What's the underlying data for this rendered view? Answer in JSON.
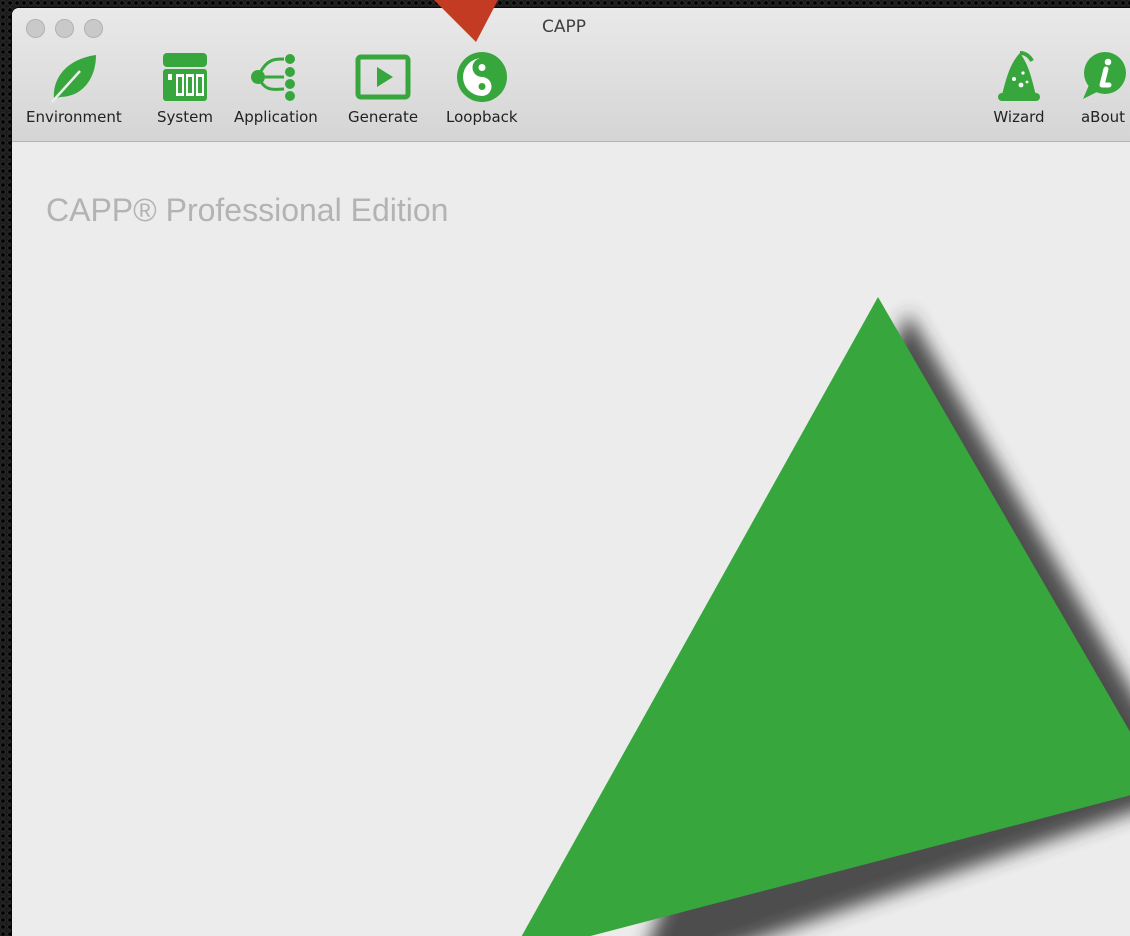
{
  "window": {
    "title": "CAPP"
  },
  "toolbar": {
    "items": [
      {
        "label": "Environment",
        "icon": "leaf-icon"
      },
      {
        "label": "System",
        "icon": "server-icon"
      },
      {
        "label": "Application",
        "icon": "flow-diagram-icon"
      },
      {
        "label": "Generate",
        "icon": "play-icon"
      },
      {
        "label": "Loopback",
        "icon": "yin-yang-icon"
      },
      {
        "label": "Wizard",
        "icon": "wizard-hat-icon"
      },
      {
        "label": "aBout",
        "icon": "info-bubble-icon"
      }
    ]
  },
  "main": {
    "edition_text": "CAPP® Professional Edition"
  },
  "colors": {
    "accent_green": "#37a63d",
    "pointer_red": "#c0392b"
  }
}
